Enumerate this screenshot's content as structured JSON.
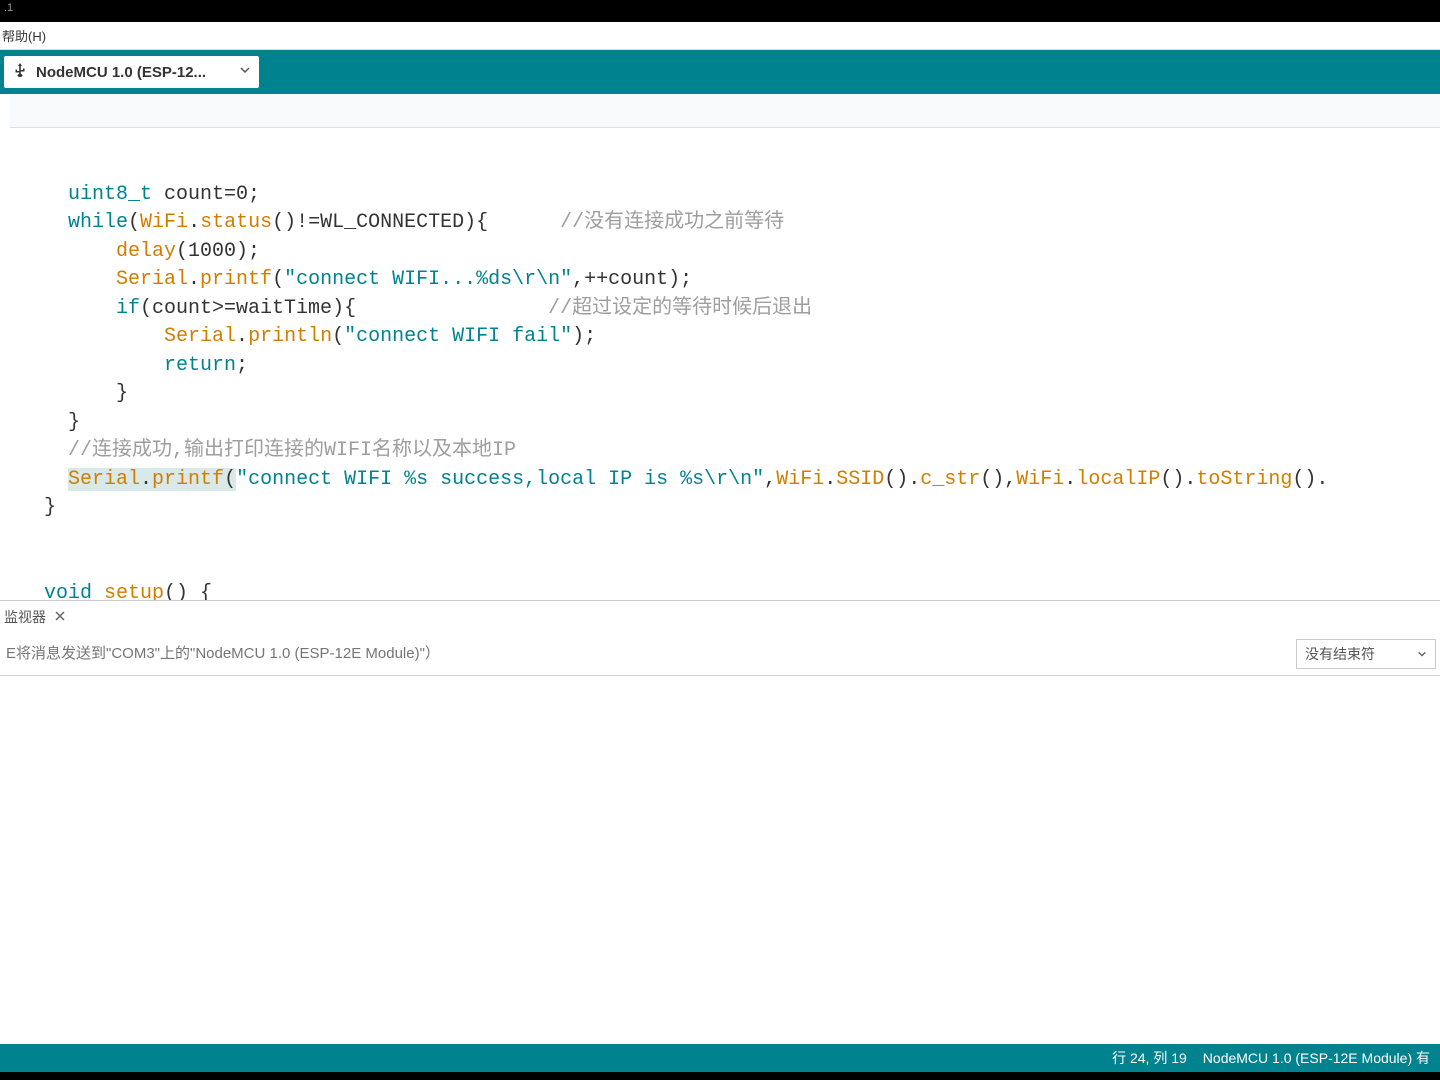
{
  "titlebar": {
    "text": ".1"
  },
  "menubar": {
    "help": "帮助(H)"
  },
  "toolbar": {
    "board": "NodeMCU 1.0 (ESP-12..."
  },
  "code": {
    "l1": {
      "a": "uint8_t",
      "b": " count=0;"
    },
    "l2": {
      "a": "while",
      "b": "(",
      "c": "WiFi",
      "d": ".",
      "e": "status",
      "f": "()!=WL_CONNECTED){      ",
      "g": "//没有连接成功之前等待"
    },
    "l3": {
      "a": "delay",
      "b": "(1000);"
    },
    "l4": {
      "a": "Serial",
      "b": ".",
      "c": "printf",
      "d": "(",
      "e": "\"connect WIFI...%ds\\r\\n\"",
      "f": ",++count);"
    },
    "l5": {
      "a": "if",
      "b": "(count>=waitTime){                ",
      "c": "//超过设定的等待时候后退出"
    },
    "l6": {
      "a": "Serial",
      "b": ".",
      "c": "println",
      "d": "(",
      "e": "\"connect WIFI fail\"",
      "f": ");"
    },
    "l7": {
      "a": "return",
      "b": ";"
    },
    "l8": "      }",
    "l9": "  }",
    "l10": "  //连接成功,输出打印连接的WIFI名称以及本地IP",
    "l11": {
      "a": "Serial",
      "b": ".",
      "c": "printf",
      "d": "(",
      "e": "\"connect WIFI %s success,local IP is %s\\r\\n\"",
      "f": ",",
      "g": "WiFi",
      "h": ".",
      "i": "SSID",
      "j": "().",
      "k": "c_str",
      "l": "(),",
      "m": "WiFi",
      "n": ".",
      "o": "localIP",
      "p": "().",
      "q": "toString",
      "r": "()."
    },
    "l12": "}",
    "l13": "",
    "l14": "",
    "l15a": "void",
    "l15b": " ",
    "l15c": "setup",
    "l15d": "() {"
  },
  "monitor": {
    "title": "监视器",
    "placeholder": "E将消息发送到\"COM3\"上的\"NodeMCU 1.0 (ESP-12E Module)\"）",
    "line_ending": "没有结束符"
  },
  "status": {
    "cursor": "行 24, 列 19",
    "board": "NodeMCU 1.0 (ESP-12E Module) 有"
  }
}
